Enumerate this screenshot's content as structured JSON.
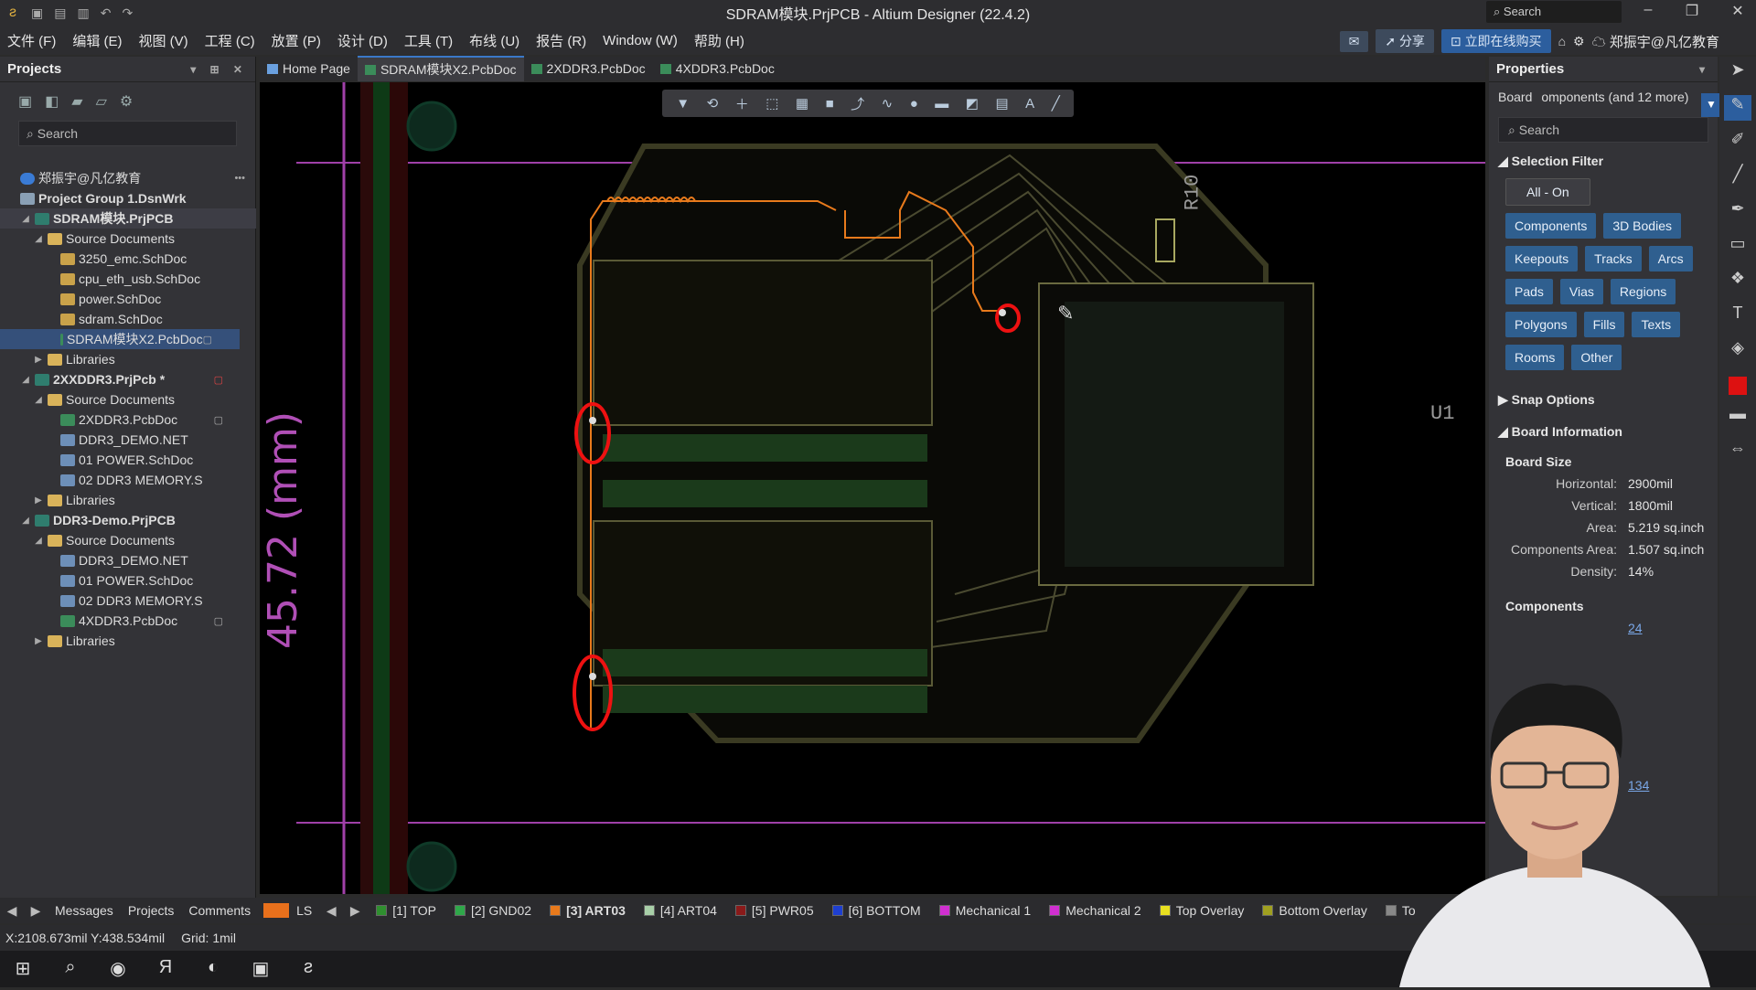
{
  "window": {
    "title": "SDRAM模块.PrjPCB - Altium Designer (22.4.2)",
    "search_placeholder": "Search"
  },
  "menu": {
    "items": [
      "文件 (F)",
      "编辑 (E)",
      "视图 (V)",
      "工程 (C)",
      "放置 (P)",
      "设计 (D)",
      "工具 (T)",
      "布线 (U)",
      "报告 (R)",
      "Window (W)",
      "帮助 (H)"
    ],
    "share": "分享",
    "buy": "立即在线购买",
    "user": "郑振宇@凡亿教育"
  },
  "projects_panel": {
    "title": "Projects",
    "search_placeholder": "Search",
    "account": "郑振宇@凡亿教育",
    "group": "Project Group 1.DsnWrk",
    "projects": [
      {
        "name": "SDRAM模块.PrjPCB",
        "source_label": "Source Documents",
        "docs": [
          "3250_emc.SchDoc",
          "cpu_eth_usb.SchDoc",
          "power.SchDoc",
          "sdram.SchDoc",
          "SDRAM模块X2.PcbDoc"
        ],
        "libraries": "Libraries"
      },
      {
        "name": "2XXDDR3.PrjPcb *",
        "source_label": "Source Documents",
        "docs": [
          "2XDDR3.PcbDoc",
          "DDR3_DEMO.NET",
          "01 POWER.SchDoc",
          "02 DDR3 MEMORY.S"
        ],
        "libraries": "Libraries"
      },
      {
        "name": "DDR3-Demo.PrjPCB",
        "source_label": "Source Documents",
        "docs": [
          "DDR3_DEMO.NET",
          "01 POWER.SchDoc",
          "02 DDR3 MEMORY.S",
          "4XDDR3.PcbDoc"
        ],
        "libraries": "Libraries"
      }
    ]
  },
  "tabs": [
    "Home Page",
    "SDRAM模块X2.PcbDoc",
    "2XDDR3.PcbDoc",
    "4XDDR3.PcbDoc"
  ],
  "canvas": {
    "ruler_label": "45.72 (mm)",
    "designators": [
      "R10",
      "U1"
    ]
  },
  "properties": {
    "title": "Properties",
    "board_label": "Board",
    "board_value": "omponents (and 12 more)",
    "search_placeholder": "Search",
    "selection_filter": "Selection Filter",
    "all_on": "All - On",
    "filters": [
      "Components",
      "3D Bodies",
      "Keepouts",
      "Tracks",
      "Arcs",
      "Pads",
      "Vias",
      "Regions",
      "Polygons",
      "Fills",
      "Texts",
      "Rooms",
      "Other"
    ],
    "snap_options": "Snap Options",
    "board_information": "Board Information",
    "board_size": "Board Size",
    "rows": [
      {
        "k": "Horizontal:",
        "v": "2900mil"
      },
      {
        "k": "Vertical:",
        "v": "1800mil"
      },
      {
        "k": "Area:",
        "v": "5.219 sq.inch"
      },
      {
        "k": "Components Area:",
        "v": "1.507 sq.inch"
      },
      {
        "k": "Density:",
        "v": "14%"
      }
    ],
    "components": "Components",
    "components_total": "24",
    "nets_value": "134"
  },
  "layerbar": {
    "tabs": [
      "Messages",
      "Projects",
      "Comments"
    ],
    "ls": "LS",
    "layers": [
      {
        "name": "[1] TOP",
        "color": "#2f8f2f"
      },
      {
        "name": "[2] GND02",
        "color": "#2fa84a"
      },
      {
        "name": "[3] ART03",
        "color": "#e87a1c"
      },
      {
        "name": "[4] ART04",
        "color": "#a8cfa8"
      },
      {
        "name": "[5] PWR05",
        "color": "#8a1a1a"
      },
      {
        "name": "[6] BOTTOM",
        "color": "#1e3fd0"
      },
      {
        "name": "Mechanical 1",
        "color": "#d02fd0"
      },
      {
        "name": "Mechanical 2",
        "color": "#d02fd0"
      },
      {
        "name": "Top Overlay",
        "color": "#e8e020"
      },
      {
        "name": "Bottom Overlay",
        "color": "#a0a020"
      },
      {
        "name": "To",
        "color": "#888888"
      }
    ]
  },
  "status": {
    "coords": "X:2108.673mil Y:438.534mil",
    "grid": "Grid: 1mil"
  }
}
